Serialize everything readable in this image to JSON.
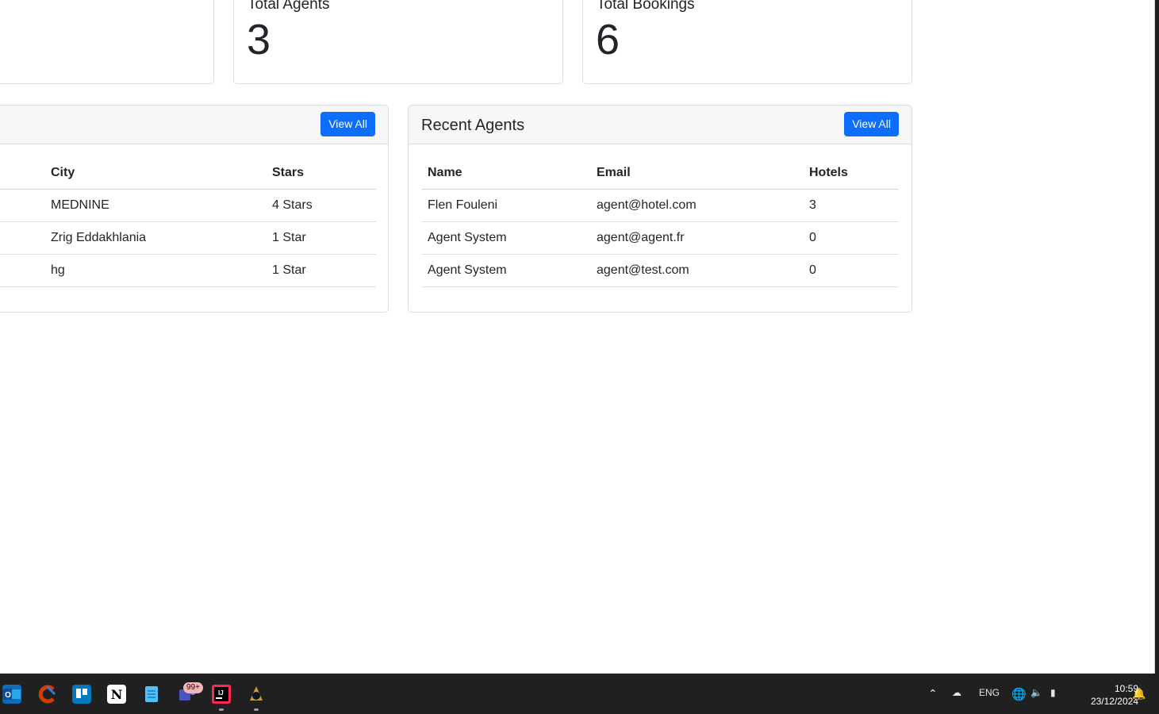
{
  "stats": {
    "agents": {
      "title": "Total Agents",
      "value": "3"
    },
    "bookings": {
      "title": "Total Bookings",
      "value": "6"
    }
  },
  "hotels_panel": {
    "view_all": "View All",
    "columns": [
      "City",
      "Stars"
    ],
    "rows": [
      {
        "city": "MEDNINE",
        "stars": "4 Stars"
      },
      {
        "city": "Zrig Eddakhlania",
        "stars": "1 Star"
      },
      {
        "city": "hg",
        "stars": "1 Star"
      }
    ]
  },
  "agents_panel": {
    "title": "Recent Agents",
    "view_all": "View All",
    "columns": [
      "Name",
      "Email",
      "Hotels"
    ],
    "rows": [
      {
        "name": "Flen Fouleni",
        "email": "agent@hotel.com",
        "hotels": "3"
      },
      {
        "name": "Agent System",
        "email": "agent@agent.fr",
        "hotels": "0"
      },
      {
        "name": "Agent System",
        "email": "agent@test.com",
        "hotels": "0"
      }
    ]
  },
  "taskbar": {
    "badge": "99+",
    "language": "ENG",
    "time": "10:59",
    "date": "23/12/2024",
    "colors": {
      "accent": "#0d6efd",
      "taskbar": "#202020"
    },
    "apps": [
      "outlook-icon",
      "ccleaner-icon",
      "trello-icon",
      "notion-icon",
      "notepad-icon",
      "teams-icon",
      "intellij-icon",
      "league-icon"
    ]
  }
}
